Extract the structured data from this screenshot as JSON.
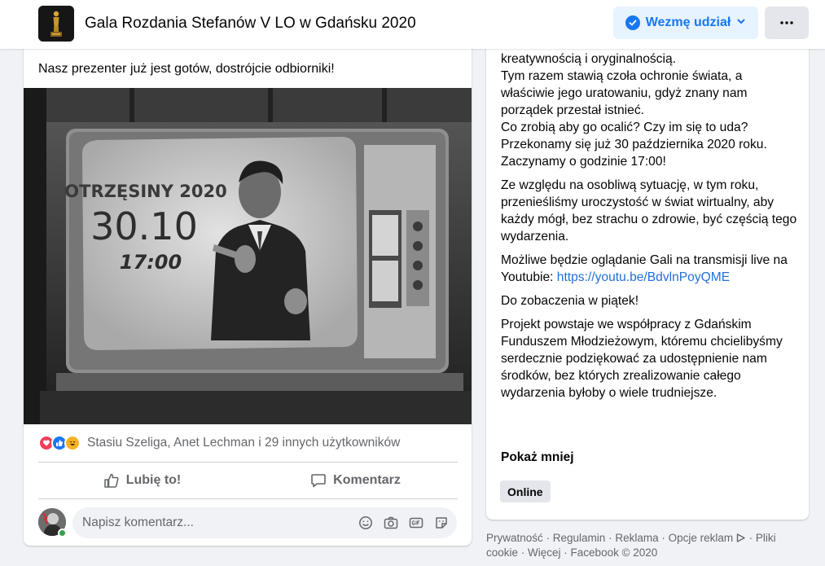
{
  "header": {
    "event_title": "Gala Rozdania Stefanów V LO w Gdańsku 2020",
    "going_label": "Wezmę udział",
    "more_label": "···"
  },
  "post": {
    "text": "Nasz prezenter już jest gotów, dostrójcie odbiorniki!",
    "image": {
      "tv_title": "OTRZĘSINY 2020",
      "tv_date": "30.10",
      "tv_time": "17:00"
    },
    "reactions_text": "Stasiu Szeliga, Anet Lechman i 29 innych użytkowników",
    "like_label": "Lubię to!",
    "comment_label": "Komentarz",
    "comment_placeholder": "Napisz komentarz..."
  },
  "details": {
    "line1": "kreatywnością i oryginalnością.",
    "line2": "Tym razem stawią czoła ochronie świata, a właściwie jego uratowaniu, gdyż znany nam porządek przestał istnieć.",
    "line3": "Co zrobią aby go ocalić? Czy im się to uda? Przekonamy się już 30 października 2020 roku. Zaczynamy o godzinie 17:00!",
    "para2": "Ze względu na osobliwą sytuację, w tym roku, przenieśliśmy uroczystość w świat wirtualny, aby każdy mógł, bez strachu o zdrowie, być częścią tego wydarzenia.",
    "para3_text": "Możliwe będzie oglądanie Gali na transmisji live na Youtubie: ",
    "para3_link": "https://youtu.be/BdvlnPoyQME",
    "para4": "Do zobaczenia w piątek!",
    "para5": "Projekt powstaje we współpracy z Gdańskim Funduszem Młodzieżowym, któremu chcielibyśmy serdecznie podziękować za udostępnienie nam środków, bez których zrealizowanie całego wydarzenia byłoby o wiele trudniejsze.",
    "show_less": "Pokaż mniej",
    "online_tag": "Online"
  },
  "footer": {
    "privacy": "Prywatność",
    "terms": "Regulamin",
    "ads": "Reklama",
    "ad_choices": "Opcje reklam",
    "cookies": "Pliki cookie",
    "more": "Więcej",
    "copyright": "Facebook © 2020",
    "separator": " · "
  },
  "colors": {
    "accent": "#1877f2",
    "accent_bg": "#e7f3ff",
    "secondary_text": "#65676b",
    "background": "#f0f2f5",
    "online": "#31a24c"
  }
}
